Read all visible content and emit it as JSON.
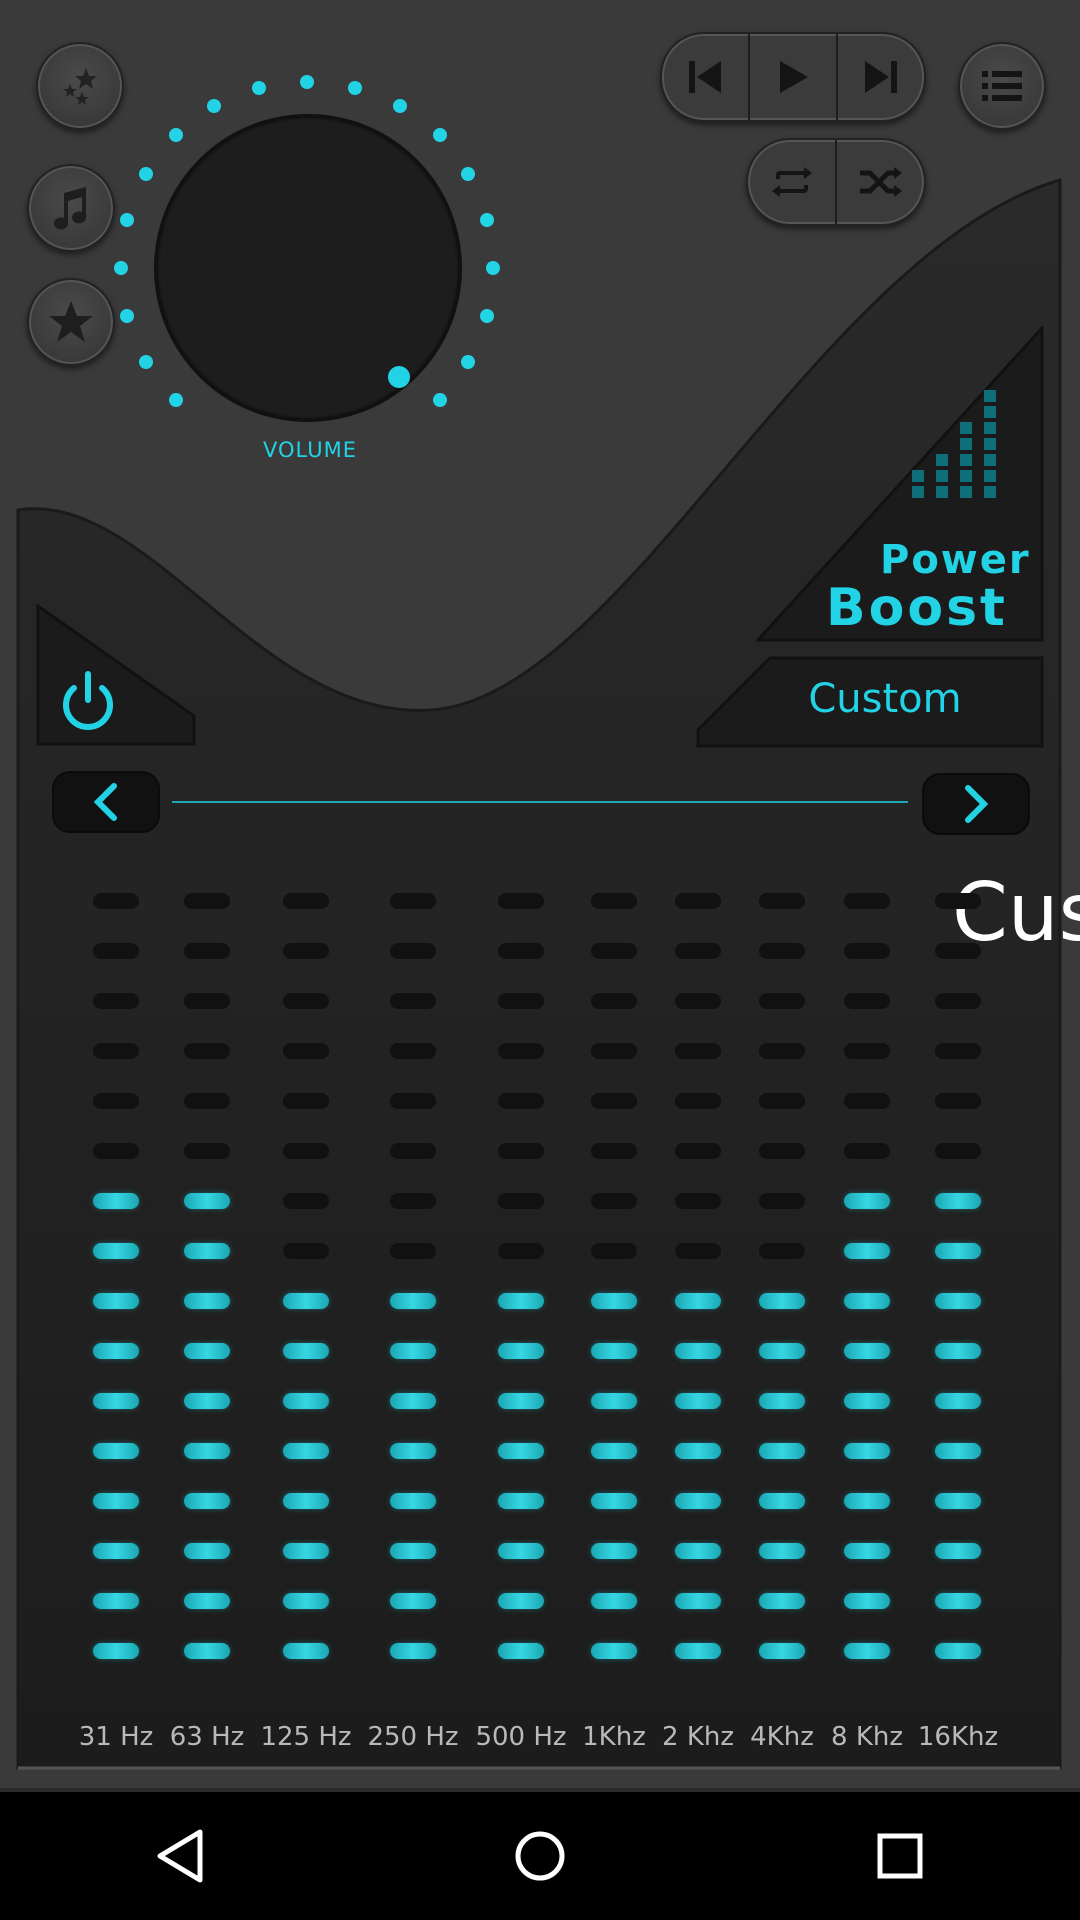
{
  "knob": {
    "label": "VOLUME"
  },
  "power_boost": {
    "line1": "Power",
    "line2": "Boost"
  },
  "preset": {
    "label": "Custom",
    "overlay_text": "Cus"
  },
  "eq": {
    "bands": [
      {
        "label": "31 Hz",
        "active": 10
      },
      {
        "label": "63 Hz",
        "active": 10
      },
      {
        "label": "125 Hz",
        "active": 8
      },
      {
        "label": "250 Hz",
        "active": 8
      },
      {
        "label": "500 Hz",
        "active": 8
      },
      {
        "label": "1Khz",
        "active": 8
      },
      {
        "label": "2 Khz",
        "active": 8
      },
      {
        "label": "4Khz",
        "active": 8
      },
      {
        "label": "8 Khz",
        "active": 10
      },
      {
        "label": "16Khz",
        "active": 10
      }
    ],
    "total_segments": 16
  },
  "icons": {
    "effects": "sparkles-icon",
    "music": "music-note-icon",
    "favorite": "star-icon",
    "prev": "skip-previous-icon",
    "play": "play-icon",
    "next": "skip-next-icon",
    "playlist": "list-icon",
    "repeat": "repeat-icon",
    "shuffle": "shuffle-icon",
    "power": "power-icon",
    "left": "chevron-left-icon",
    "right": "chevron-right-icon"
  },
  "colors": {
    "accent": "#22d3e6",
    "background": "#3a3a3a",
    "panel": "#1f1f1f"
  }
}
